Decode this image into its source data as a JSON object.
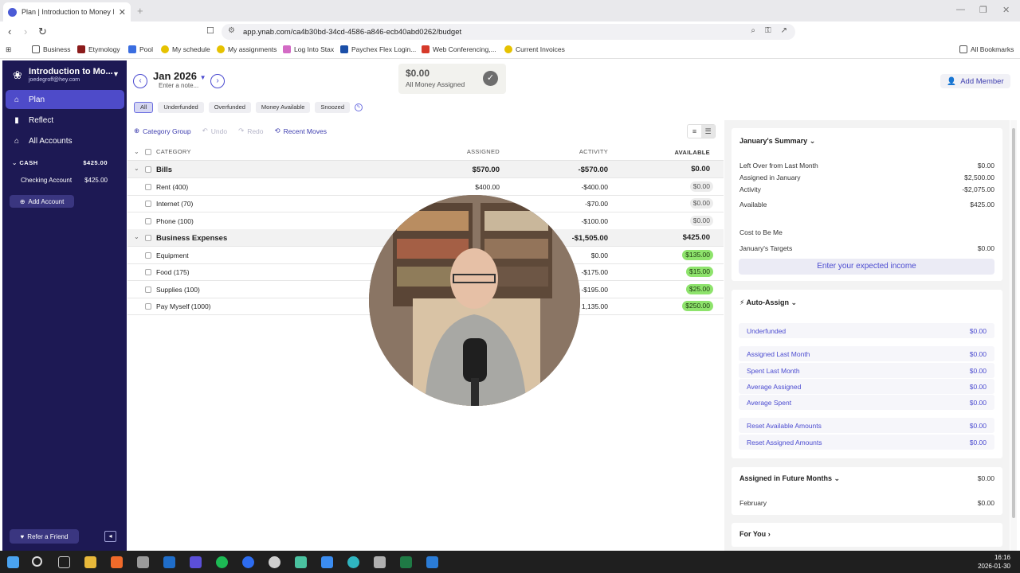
{
  "browser": {
    "tab_title": "Plan | Introduction to Money Ma",
    "url": "app.ynab.com/ca4b30bd-34cd-4586-a846-ecb40abd0262/budget",
    "bookmarks": [
      "Business",
      "Etymology",
      "Pool",
      "My schedule",
      "My assignments",
      "Log Into Stax",
      "Paychex Flex Login...",
      "Web Conferencing,...",
      "Current Invoices"
    ],
    "all_bookmarks": "All Bookmarks"
  },
  "sidebar": {
    "budget_name": "Introduction to Mo...",
    "email": "joedegroff@hey.com",
    "nav": [
      "Plan",
      "Reflect",
      "All Accounts"
    ],
    "cash_label": "CASH",
    "cash_total": "$425.00",
    "accounts": [
      {
        "name": "Checking Account",
        "balance": "$425.00"
      }
    ],
    "add_account": "Add Account",
    "refer": "Refer a Friend"
  },
  "header": {
    "month": "Jan 2026",
    "note": "Enter a note...",
    "assigned_amount": "$0.00",
    "assigned_label": "All Money Assigned",
    "add_member": "Add Member"
  },
  "filters": [
    "All",
    "Underfunded",
    "Overfunded",
    "Money Available",
    "Snoozed"
  ],
  "toolbar": {
    "category_group": "Category Group",
    "undo": "Undo",
    "redo": "Redo",
    "recent_moves": "Recent Moves"
  },
  "table": {
    "headers": {
      "category": "CATEGORY",
      "assigned": "ASSIGNED",
      "activity": "ACTIVITY",
      "available": "AVAILABLE"
    },
    "rows": [
      {
        "group": true,
        "name": "Bills",
        "assigned": "$570.00",
        "activity": "-$570.00",
        "available": "$0.00",
        "style": "plain"
      },
      {
        "group": false,
        "name": "Rent (400)",
        "assigned": "$400.00",
        "activity": "-$400.00",
        "available": "$0.00",
        "style": "zero"
      },
      {
        "group": false,
        "name": "Internet (70)",
        "assigned": "",
        "activity": "-$70.00",
        "available": "$0.00",
        "style": "zero"
      },
      {
        "group": false,
        "name": "Phone (100)",
        "assigned": "",
        "activity": "-$100.00",
        "available": "$0.00",
        "style": "zero"
      },
      {
        "group": true,
        "name": "Business Expenses",
        "assigned": "",
        "activity": "-$1,505.00",
        "available": "$425.00",
        "style": "plain"
      },
      {
        "group": false,
        "name": "Equipment",
        "assigned": "",
        "activity": "$0.00",
        "available": "$135.00",
        "style": "green"
      },
      {
        "group": false,
        "name": "Food (175)",
        "assigned": "",
        "activity": "-$175.00",
        "available": "$15.00",
        "style": "green"
      },
      {
        "group": false,
        "name": "Supplies (100)",
        "assigned": "",
        "activity": "-$195.00",
        "available": "$25.00",
        "style": "green"
      },
      {
        "group": false,
        "name": "Pay Myself (1000)",
        "assigned": "",
        "activity": "1,135.00",
        "available": "$250.00",
        "style": "green"
      }
    ]
  },
  "summary": {
    "title": "January's Summary",
    "items": [
      {
        "label": "Left Over from Last Month",
        "value": "$0.00"
      },
      {
        "label": "Assigned in January",
        "value": "$2,500.00"
      },
      {
        "label": "Activity",
        "value": "-$2,075.00"
      },
      {
        "label": "Available",
        "value": "$425.00"
      }
    ],
    "cost_to_be_me": "Cost to Be Me",
    "targets_label": "January's Targets",
    "targets_value": "$0.00",
    "income_button": "Enter your expected income"
  },
  "auto_assign": {
    "title": "Auto-Assign",
    "items": [
      {
        "label": "Underfunded",
        "value": "$0.00"
      },
      {
        "label": "Assigned Last Month",
        "value": "$0.00"
      },
      {
        "label": "Spent Last Month",
        "value": "$0.00"
      },
      {
        "label": "Average Assigned",
        "value": "$0.00"
      },
      {
        "label": "Average Spent",
        "value": "$0.00"
      },
      {
        "label": "Reset Available Amounts",
        "value": "$0.00"
      },
      {
        "label": "Reset Assigned Amounts",
        "value": "$0.00"
      }
    ]
  },
  "future": {
    "title": "Assigned in Future Months",
    "total": "$0.00",
    "month_label": "February",
    "month_value": "$0.00"
  },
  "for_you": "For You",
  "clock": {
    "time": "16:16",
    "date": "2026-01-30"
  },
  "colors": {
    "sidebar": "#1d1954",
    "accent": "#4b4bd0",
    "available_green": "#8ee36c"
  }
}
